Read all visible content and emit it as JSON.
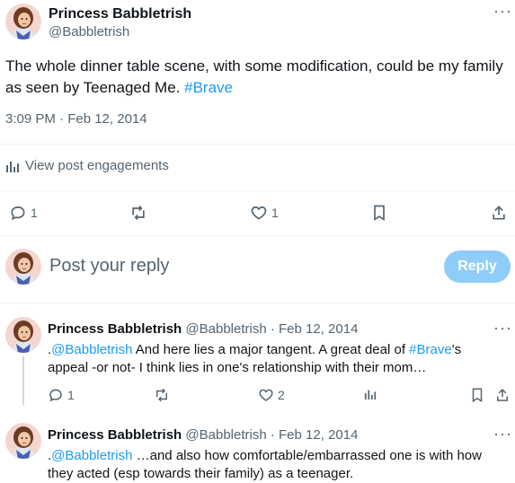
{
  "main_post": {
    "display_name": "Princess Babbletrish",
    "handle": "@Babbletrish",
    "text_before": "The whole dinner table scene, with some modification, could be my family as seen by Teenaged Me. ",
    "hashtag": "#Brave",
    "timestamp": "3:09 PM · Feb 12, 2014",
    "engagements_label": "View post engagements",
    "reply_count": "1",
    "like_count": "1",
    "more": "···"
  },
  "composer": {
    "placeholder": "Post your reply",
    "button_label": "Reply"
  },
  "replies": [
    {
      "display_name": "Princess Babbletrish",
      "handle": "@Babbletrish",
      "date": " · Feb 12, 2014",
      "prefix": ".",
      "mention": "@Babbletrish",
      "text_a": " And here lies a major tangent. A great deal of ",
      "hashtag": "#Brave",
      "text_b": "'s appeal -or not- I think lies in one's relationship with their mom…",
      "reply_count": "1",
      "like_count": "2",
      "more": "···"
    },
    {
      "display_name": "Princess Babbletrish",
      "handle": "@Babbletrish",
      "date": " · Feb 12, 2014",
      "prefix": ".",
      "mention": "@Babbletrish",
      "text_a": " …and also how comfortable/embarrassed one is with how they acted (esp towards their family) as a teenager.",
      "more": "···"
    }
  ],
  "colors": {
    "accent": "#1d9bf0",
    "reply_button": "#8ecdf7",
    "muted": "#536471",
    "text": "#0f1419"
  }
}
